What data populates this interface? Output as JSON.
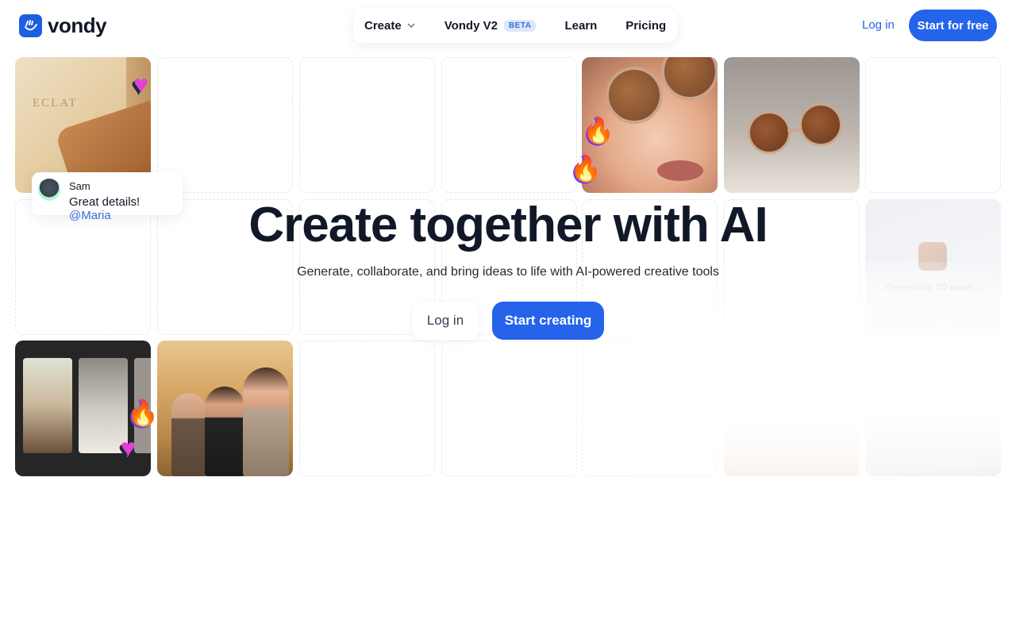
{
  "header": {
    "logo_text": "vondy",
    "nav": {
      "create": "Create",
      "vondy_v2": "Vondy V2",
      "beta": "BETA",
      "learn": "Learn",
      "pricing": "Pricing"
    },
    "login": "Log in",
    "start_free": "Start for free"
  },
  "gallery": {
    "wallet_brand": "ECLAT",
    "comment": {
      "name": "Sam",
      "text": "Great details!",
      "mention": "@Maria"
    },
    "generating_text": "Generating 3D asset..."
  },
  "hero": {
    "title": "Create together with AI",
    "subtitle": "Generate, collaborate, and bring ideas to life with AI-powered creative tools",
    "login": "Log in",
    "start": "Start creating"
  },
  "colors": {
    "accent": "#2563eb",
    "beta_bg": "#dbe7fb",
    "text": "#111827"
  },
  "icons": {
    "logo": "shaka-hand-icon",
    "dropdown": "chevron-down-icon",
    "reaction_heart": "heart-icon",
    "reaction_fire": "fire-icon"
  }
}
